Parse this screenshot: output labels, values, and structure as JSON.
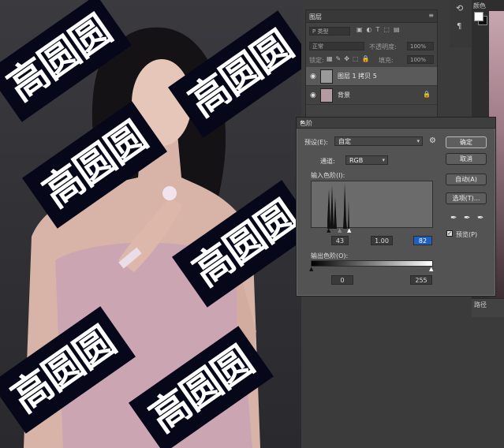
{
  "canvas": {
    "watermark": "高圆圆"
  },
  "layers_panel": {
    "tab": "图层",
    "kind_label": "P 类型",
    "blend_mode": "正常",
    "opacity_label": "不透明度:",
    "opacity_value": "100%",
    "lock_label": "锁定:",
    "fill_label": "填充:",
    "fill_value": "100%",
    "layers": [
      {
        "name": "图层 1 拷贝 5",
        "selected": true
      },
      {
        "name": "背景",
        "selected": false,
        "locked": true
      }
    ]
  },
  "color_panel": {
    "title": "颜色"
  },
  "paths_panel": {
    "title": "路径"
  },
  "levels_dialog": {
    "title": "色阶",
    "preset_label": "预设(E):",
    "preset_value": "自定",
    "channel_label": "通道:",
    "channel_value": "RGB",
    "input_label": "输入色阶(I):",
    "input_black": "43",
    "input_gamma": "1.00",
    "input_white": "82",
    "output_label": "输出色阶(O):",
    "output_black": "0",
    "output_white": "255",
    "buttons": {
      "ok": "确定",
      "cancel": "取消",
      "auto": "自动(A)",
      "options": "选项(T)..."
    },
    "preview_label": "预览(P)",
    "preview_checked": true
  }
}
